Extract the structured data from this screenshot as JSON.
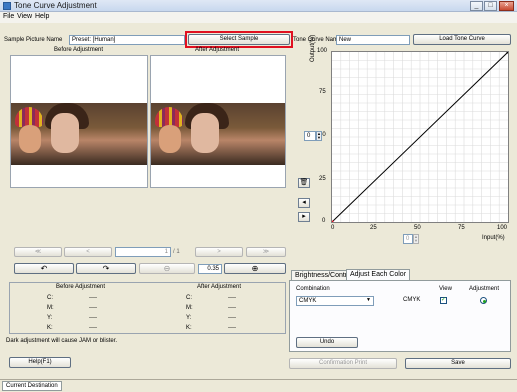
{
  "window": {
    "title": "Tone Curve Adjustment"
  },
  "menu": {
    "file": "File",
    "view": "View",
    "help": "Help"
  },
  "sample": {
    "label": "Sample Picture Name",
    "value": "Preset: [Human]",
    "select_label": "Select Sample"
  },
  "tone_curve": {
    "label": "Tone Curve Name",
    "value": "New",
    "load_label": "Load Tone Curve"
  },
  "preview": {
    "before_label": "Before Adjustment",
    "after_label": "After Adjustment"
  },
  "pager": {
    "first": "≪",
    "prev": "<",
    "page": "1",
    "total": "/ 1",
    "next": ">",
    "last": "≫"
  },
  "zoom": {
    "value": "0.35"
  },
  "density_table": {
    "before_header": "Before Adjustment",
    "after_header": "After Adjustment",
    "rows": [
      {
        "channel": "C:",
        "before": "----",
        "after": "----"
      },
      {
        "channel": "M:",
        "before": "----",
        "after": "----"
      },
      {
        "channel": "Y:",
        "before": "----",
        "after": "----"
      },
      {
        "channel": "K:",
        "before": "----",
        "after": "----"
      }
    ]
  },
  "warning": "Dark adjustment will cause JAM or blister.",
  "help_label": "Help(F1)",
  "chart": {
    "ylabel": "Output(%)",
    "xlabel": "Input(%)",
    "y_ticks": [
      "100",
      "75",
      "50",
      "25",
      "0"
    ],
    "x_ticks": [
      "0",
      "25",
      "50",
      "75",
      "100"
    ],
    "point_input": "0",
    "point_output": "0"
  },
  "tabs": {
    "brightness": "Brightness/Contrast",
    "adjust_each": "Adjust Each Color"
  },
  "color_panel": {
    "combination_label": "Combination",
    "view_label": "View",
    "adjustment_label": "Adjustment",
    "combination_value": "CMYK",
    "channel_label": "CMYK",
    "undo_label": "Undo"
  },
  "confirmation_label": "Confirmation Print",
  "save_label": "Save",
  "status": {
    "destination_tab": "Current Destination"
  },
  "chart_data": {
    "type": "line",
    "xlabel": "Input(%)",
    "ylabel": "Output(%)",
    "xlim": [
      0,
      100
    ],
    "ylim": [
      0,
      100
    ],
    "grid": true,
    "series": [
      {
        "x": [
          0,
          100
        ],
        "y": [
          0,
          100
        ]
      }
    ]
  }
}
